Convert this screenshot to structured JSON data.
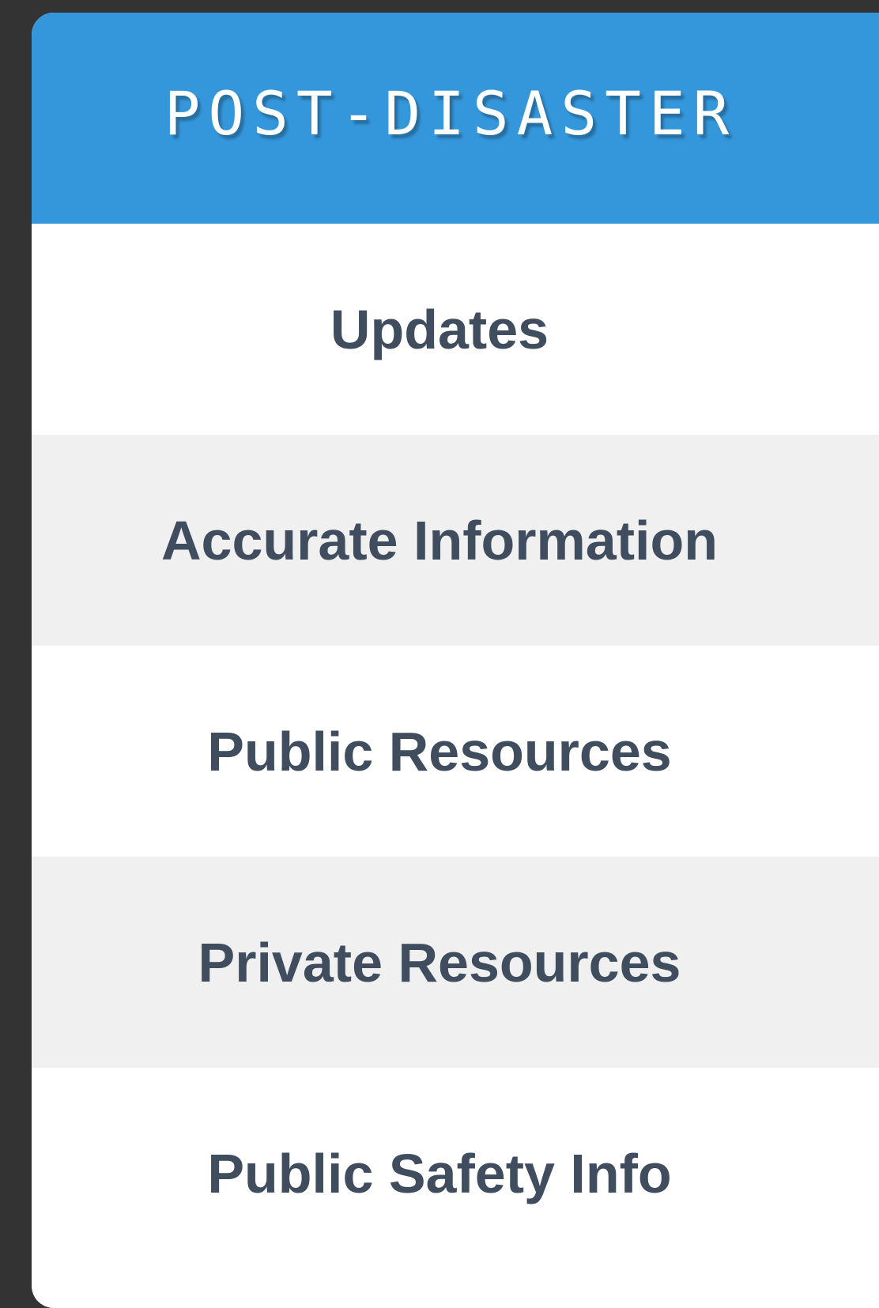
{
  "header": {
    "title": "POST-DISASTER"
  },
  "menu": {
    "items": [
      {
        "label": "Updates"
      },
      {
        "label": "Accurate Information"
      },
      {
        "label": "Public Resources"
      },
      {
        "label": "Private Resources"
      },
      {
        "label": "Public Safety Info"
      }
    ]
  },
  "colors": {
    "header_background": "#3597db",
    "menu_text": "#3f4d5e",
    "alt_row_background": "#f0f0f0",
    "outer_background": "#333333"
  }
}
